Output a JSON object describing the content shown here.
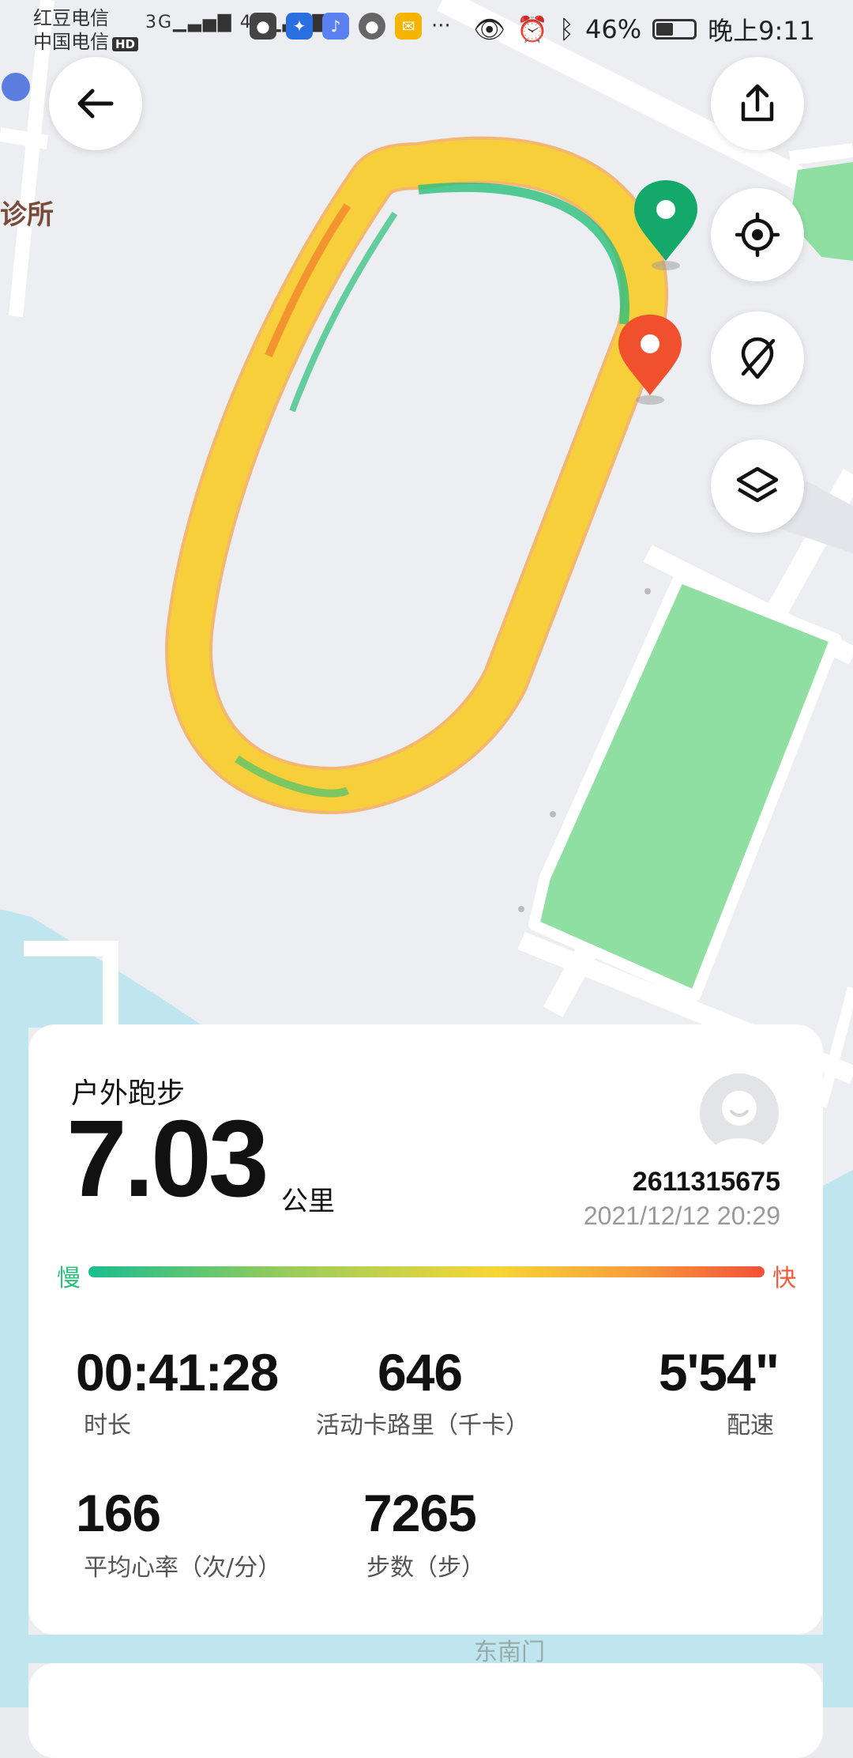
{
  "status_bar": {
    "carrier_1": "红豆电信",
    "carrier_2": "中国电信",
    "hd": "HD",
    "net_1": "3G",
    "net_2": "4G",
    "dots": "···",
    "battery_percent": "46%",
    "battery_level": 0.46,
    "time": "晚上9:11"
  },
  "map": {
    "poi_label": "诊所",
    "road_label": "东南门"
  },
  "summary": {
    "activity_type": "户外跑步",
    "distance": "7.03",
    "distance_unit": "公里",
    "user_id": "2611315675",
    "datetime": "2021/12/12 20:29",
    "slow_label": "慢",
    "fast_label": "快"
  },
  "stats": [
    {
      "value": "00:41:28",
      "label": "时长"
    },
    {
      "value": "646",
      "label": "活动卡路里（千卡）"
    },
    {
      "value": "5'54\"",
      "label": "配速"
    },
    {
      "value": "166",
      "label": "平均心率（次/分）"
    },
    {
      "value": "7265",
      "label": "步数（步）"
    }
  ],
  "colors": {
    "track_yellow": "#f7cf3a",
    "start_marker": "#14a86b",
    "end_marker": "#f0502e",
    "pace_slow": "#1bbd8f",
    "pace_fast": "#f2503a"
  }
}
